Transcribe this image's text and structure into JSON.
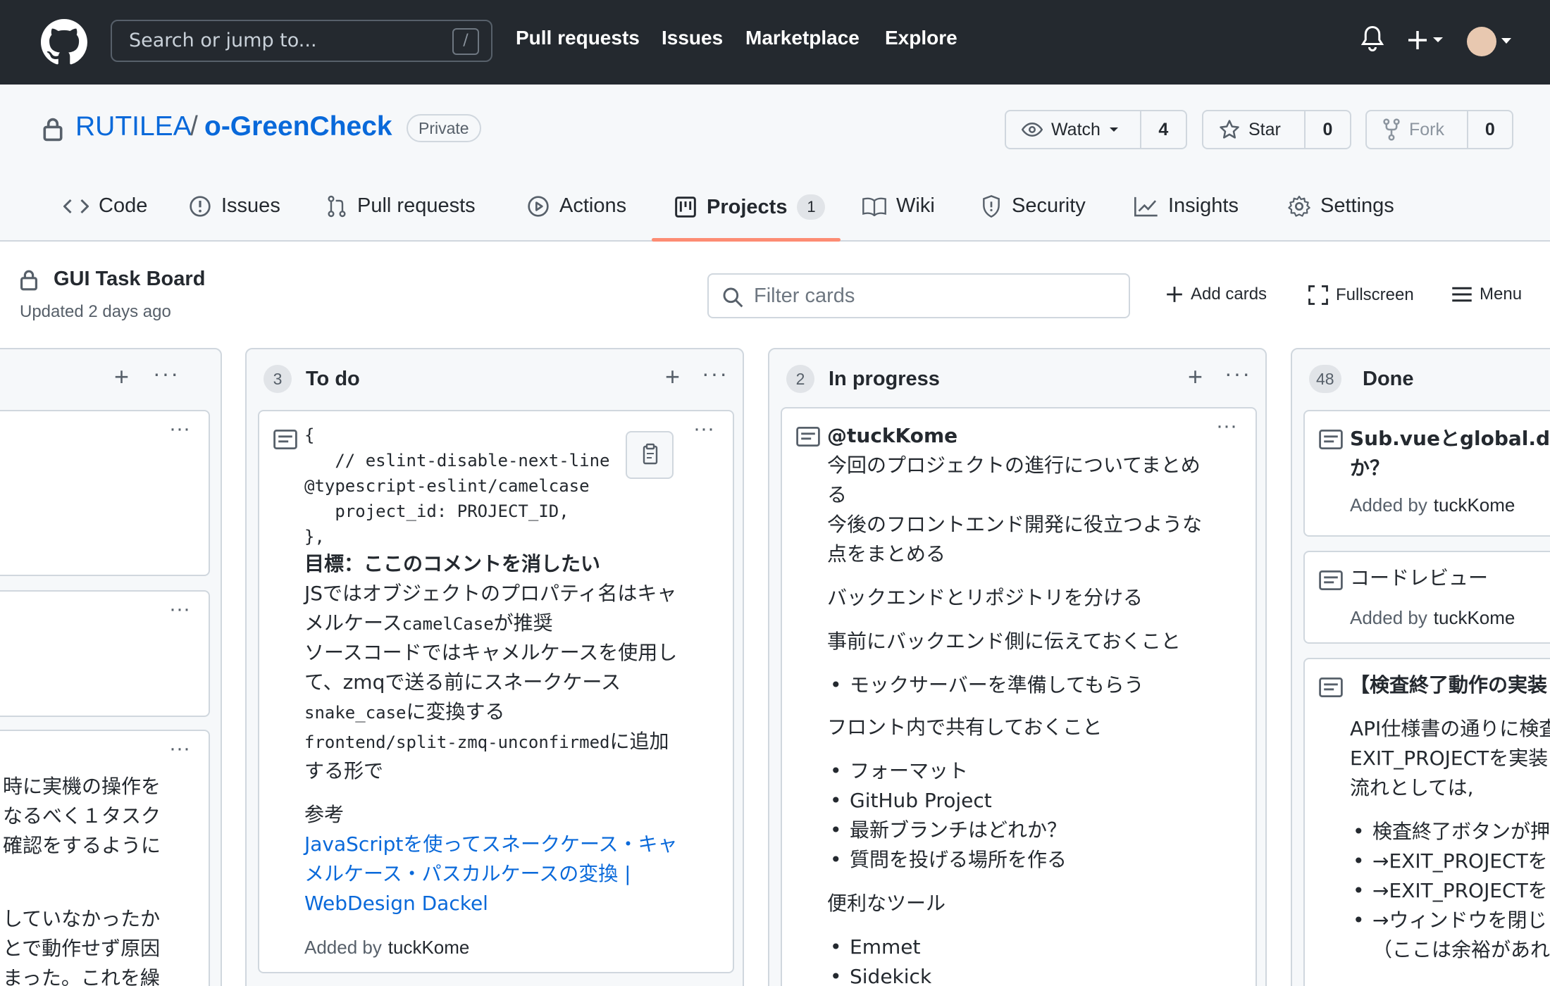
{
  "header": {
    "search_placeholder": "Search or jump to...",
    "search_shortcut": "/",
    "nav": [
      "Pull requests",
      "Issues",
      "Marketplace",
      "Explore"
    ]
  },
  "repo": {
    "owner": "RUTILEA",
    "separator": "/",
    "name": "o-GreenCheck",
    "visibility": "Private",
    "watch": {
      "label": "Watch",
      "count": "4"
    },
    "star": {
      "label": "Star",
      "count": "0"
    },
    "fork": {
      "label": "Fork",
      "count": "0"
    }
  },
  "tabs": [
    {
      "label": "Code"
    },
    {
      "label": "Issues"
    },
    {
      "label": "Pull requests"
    },
    {
      "label": "Actions"
    },
    {
      "label": "Projects",
      "count": "1"
    },
    {
      "label": "Wiki"
    },
    {
      "label": "Security"
    },
    {
      "label": "Insights"
    },
    {
      "label": "Settings"
    }
  ],
  "project": {
    "title": "GUI Task Board",
    "updated": "Updated 2 days ago",
    "filter_placeholder": "Filter cards",
    "add_cards": "Add cards",
    "fullscreen": "Fullscreen",
    "menu": "Menu"
  },
  "columns": {
    "partial": {
      "card_lines": [
        "時に実機の操作を",
        "なるべく１タスク",
        "確認をするように",
        "していなかったか",
        "とで動作せず原因",
        "まった。これを繰"
      ]
    },
    "todo": {
      "count": "3",
      "title": "To do",
      "card": {
        "code": "{\n   // eslint-disable-next-line\n@typescript-eslint/camelcase\n   project_id: PROJECT_ID,\n},",
        "goal": "目標：ここのコメントを消したい",
        "p1_l1": "JSではオブジェクトのプロパティ名はキャ",
        "p1_l2a": "メルケース",
        "p1_l2b": "camelCase",
        "p1_l2c": "が推奨",
        "p2_l1": "ソースコードではキャメルケースを使用し",
        "p2_l2": "て、zmqで送る前にスネークケース",
        "p2_l3a": "snake_case",
        "p2_l3b": "に変換する",
        "p3_l1a": "frontend/split-zmq-unconfirmed",
        "p3_l1b": "に追加",
        "p3_l2": "する形で",
        "ref_label": "参考",
        "ref_l1": "JavaScriptを使ってスネークケース・キャ",
        "ref_l2": "メルケース・パスカルケースの変換 |",
        "ref_l3": "WebDesign Dackel",
        "added_by": "Added by",
        "author": "tuckKome"
      }
    },
    "inprogress": {
      "count": "2",
      "title": "In progress",
      "card": {
        "mention": "@tuckKome",
        "l1": "今回のプロジェクトの進行についてまとめ",
        "l2": "る",
        "l3": "今後のフロントエンド開発に役立つような",
        "l4": "点をまとめる",
        "l5": "バックエンドとリポジトリを分ける",
        "l6": "事前にバックエンド側に伝えておくこと",
        "b1": "モックサーバーを準備してもらう",
        "l7": "フロント内で共有しておくこと",
        "b2": "フォーマット",
        "b3": "GitHub Project",
        "b4": "最新ブランチはどれか？",
        "b5": "質問を投げる場所を作る",
        "l8": "便利なツール",
        "b6": "Emmet",
        "b7": "Sidekick"
      }
    },
    "done": {
      "count": "48",
      "title": "Done",
      "card1": {
        "l1": "Sub.vueとglobal.d.ts",
        "l2": "か？",
        "added_by": "Added by",
        "author": "tuckKome"
      },
      "card2": {
        "title": "コードレビュー",
        "added_by": "Added by",
        "author": "tuckKome"
      },
      "card3": {
        "title": "【検査終了動作の実装",
        "l1": "API仕様書の通りに検査",
        "l2": "EXIT_PROJECTを実装",
        "l3": "流れとしては,",
        "b1": "検査終了ボタンが押",
        "b2": "→EXIT_PROJECTを",
        "b3": "→EXIT_PROJECTを",
        "b4": "→ウィンドウを閉じ",
        "b4b": "（ここは余裕があれ"
      }
    }
  }
}
